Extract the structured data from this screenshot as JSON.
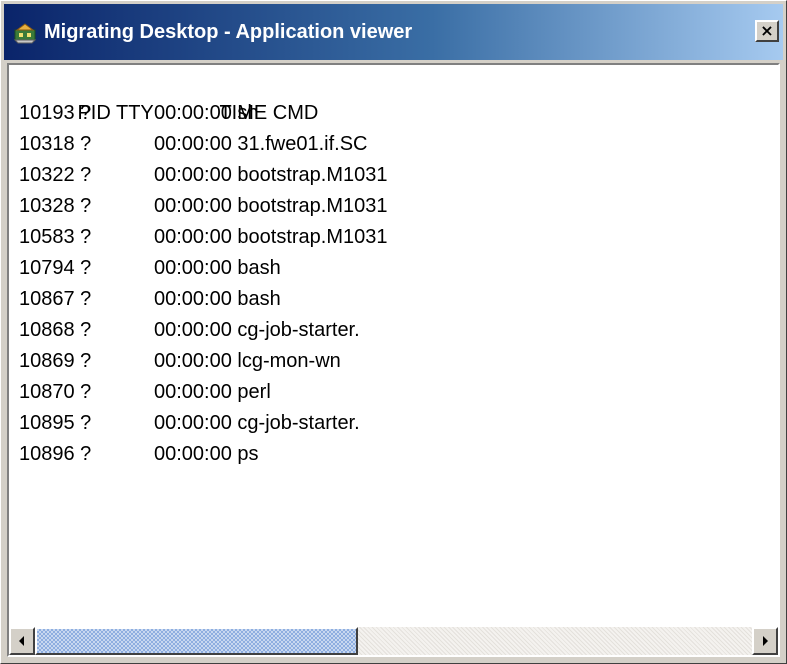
{
  "window": {
    "title": "Migrating Desktop - Application viewer",
    "close_glyph": "×",
    "icon": "desktop-app-icon"
  },
  "process_list": {
    "header": {
      "pid_tty": "PID TTY",
      "time_cmd": "TIME CMD"
    },
    "rows": [
      {
        "pid_tty": "10193 ?",
        "time_cmd": "00:00:00 sh"
      },
      {
        "pid_tty": "10318 ?",
        "time_cmd": "00:00:00 31.fwe01.if.SC"
      },
      {
        "pid_tty": "10322 ?",
        "time_cmd": "00:00:00 bootstrap.M1031"
      },
      {
        "pid_tty": "10328 ?",
        "time_cmd": "00:00:00 bootstrap.M1031"
      },
      {
        "pid_tty": "10583 ?",
        "time_cmd": "00:00:00 bootstrap.M1031"
      },
      {
        "pid_tty": "10794 ?",
        "time_cmd": "00:00:00 bash"
      },
      {
        "pid_tty": "10867 ?",
        "time_cmd": "00:00:00 bash"
      },
      {
        "pid_tty": "10868 ?",
        "time_cmd": "00:00:00 cg-job-starter."
      },
      {
        "pid_tty": "10869 ?",
        "time_cmd": "00:00:00 lcg-mon-wn"
      },
      {
        "pid_tty": "10870 ?",
        "time_cmd": "00:00:00 perl"
      },
      {
        "pid_tty": "10895 ?",
        "time_cmd": "00:00:00 cg-job-starter."
      },
      {
        "pid_tty": "10896 ?",
        "time_cmd": "00:00:00 ps"
      }
    ]
  },
  "scrollbar": {
    "thumb_fraction": 0.45,
    "position_fraction": 0.0
  },
  "colors": {
    "titlebar_start": "#0a246a",
    "titlebar_end": "#a6caf0",
    "chrome": "#d4d0c8",
    "content_bg": "#ffffff",
    "thumb": "#8eaee0"
  }
}
